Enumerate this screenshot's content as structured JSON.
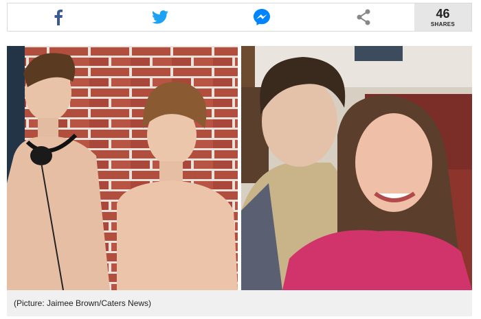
{
  "share_bar": {
    "buttons": [
      {
        "name": "facebook",
        "icon": "facebook-icon",
        "color": "#3b5998"
      },
      {
        "name": "twitter",
        "icon": "twitter-icon",
        "color": "#1da1f2"
      },
      {
        "name": "messenger",
        "icon": "messenger-icon",
        "color": "#0084ff"
      },
      {
        "name": "share",
        "icon": "share-icon",
        "color": "#888888"
      }
    ],
    "count": "46",
    "count_label": "SHARES"
  },
  "photo": {
    "left_description_icon": "photo-two-boys",
    "right_description_icon": "photo-selfie-couple"
  },
  "caption": "(Picture: Jaimee Brown/Caters News)"
}
